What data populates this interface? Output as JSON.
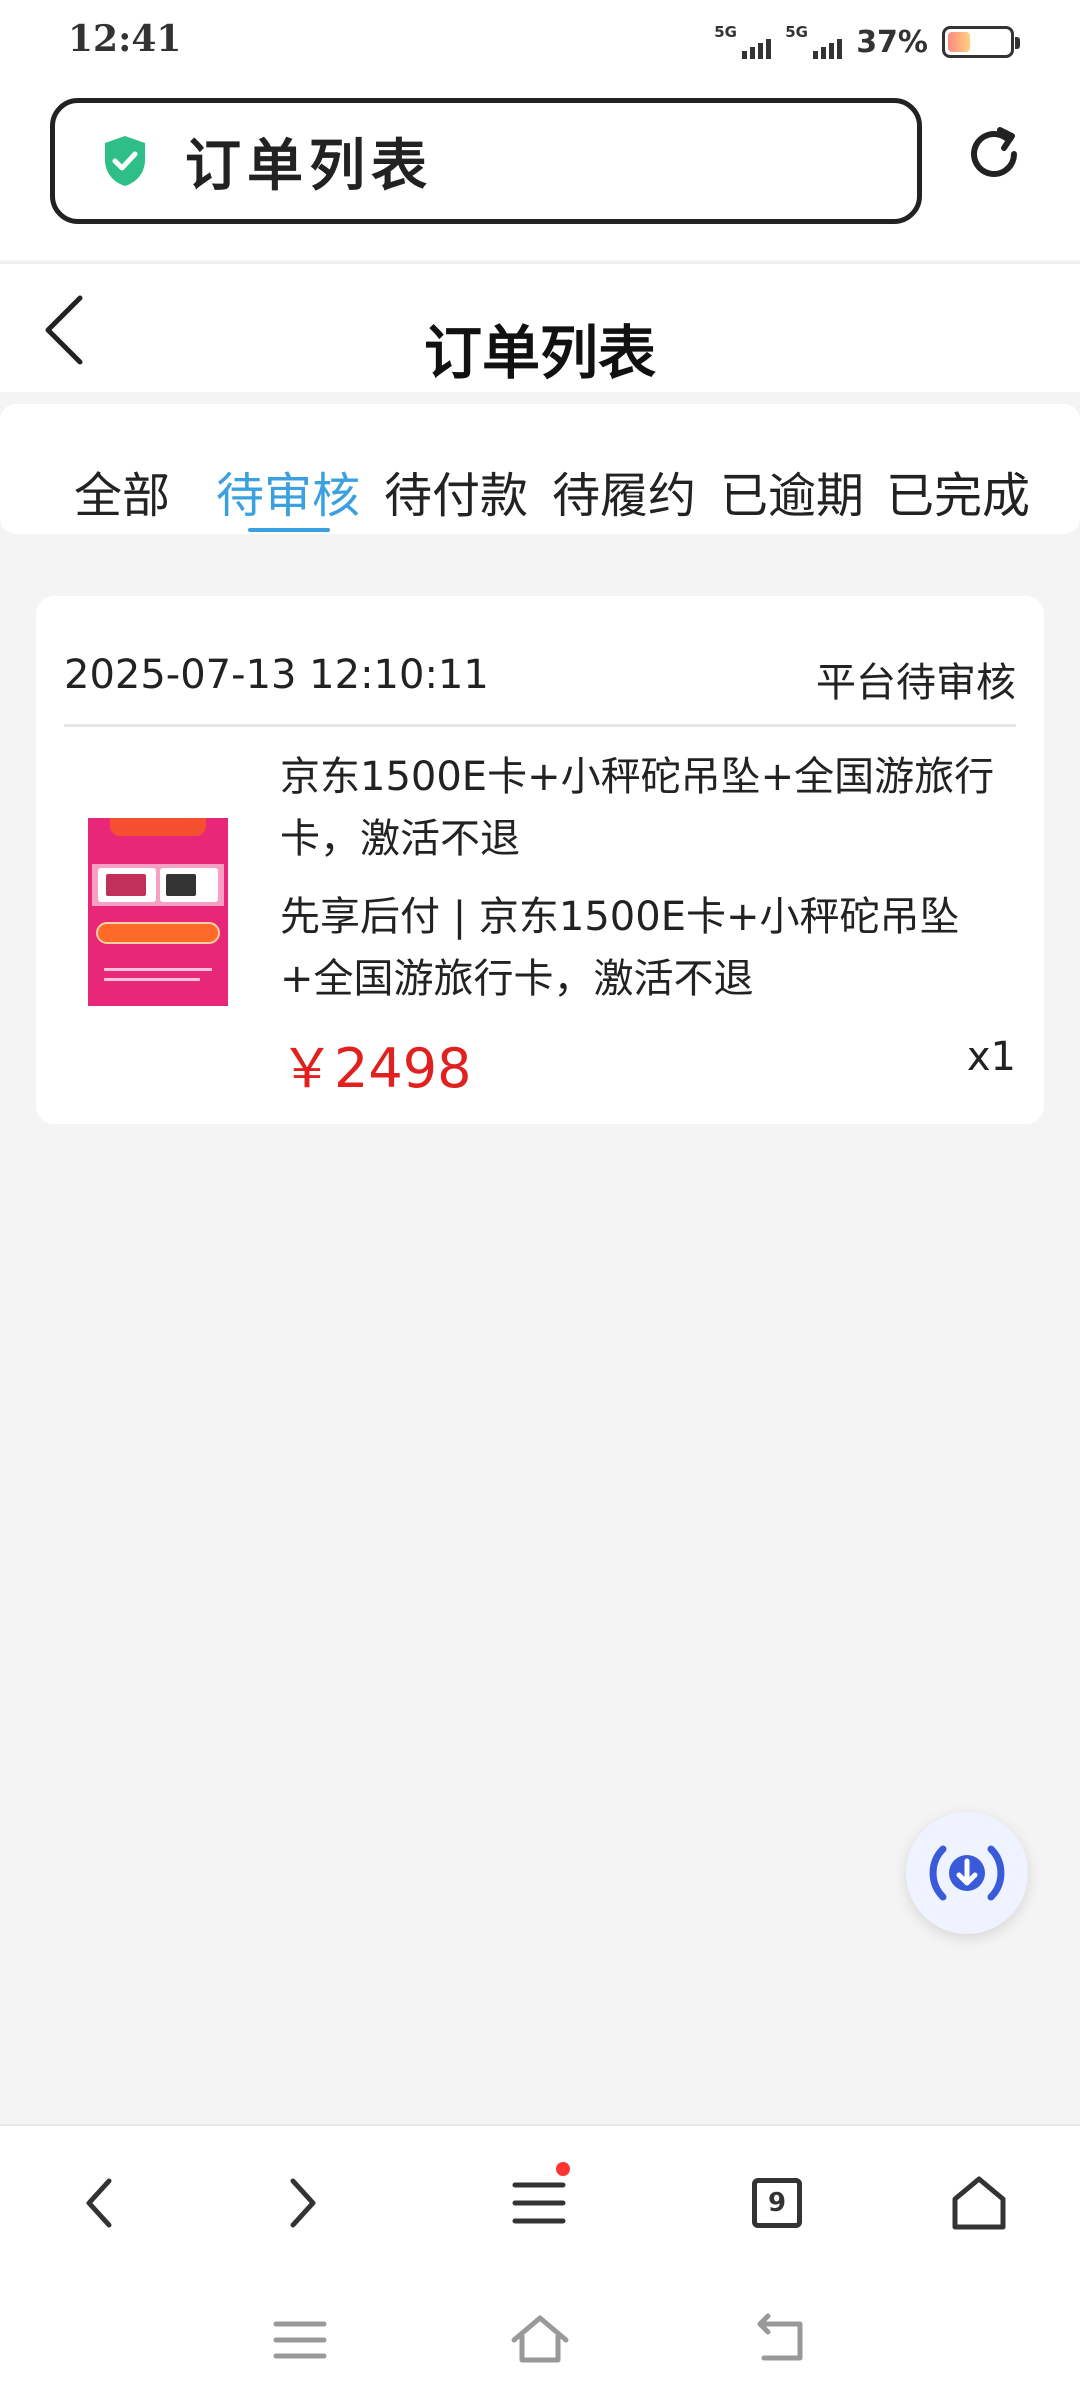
{
  "status_bar": {
    "time": "12:41",
    "sim1": "5G",
    "sim2": "5G",
    "battery": "37%",
    "battery_level": 0.37
  },
  "address_bar": {
    "title": "订单列表",
    "secure_icon": "shield-check-icon",
    "reload_icon": "reload-icon"
  },
  "header": {
    "title": "订单列表",
    "back_icon": "chevron-left-icon"
  },
  "tabs": [
    {
      "label": "全部"
    },
    {
      "label": "待审核",
      "active": true
    },
    {
      "label": "待付款"
    },
    {
      "label": "待履约"
    },
    {
      "label": "已逾期"
    },
    {
      "label": "已完成"
    }
  ],
  "orders": [
    {
      "datetime": "2025-07-13 12:10:11",
      "status": "平台待审核",
      "product_title": "京东1500E卡+小秤砣吊坠+全国游旅行卡，激活不退",
      "product_subtitle": "先享后付 | 京东1500E卡+小秤砣吊坠+全国游旅行卡，激活不退",
      "price": "￥2498",
      "quantity": "x1"
    }
  ],
  "toolbar": {
    "back_icon": "chevron-left-icon",
    "forward_icon": "chevron-right-icon",
    "menu_icon": "menu-icon",
    "tab_count": "9",
    "home_icon": "home-icon"
  },
  "colors": {
    "accent": "#3aa0e0",
    "price": "#e0211f",
    "shield": "#2dbf87"
  }
}
